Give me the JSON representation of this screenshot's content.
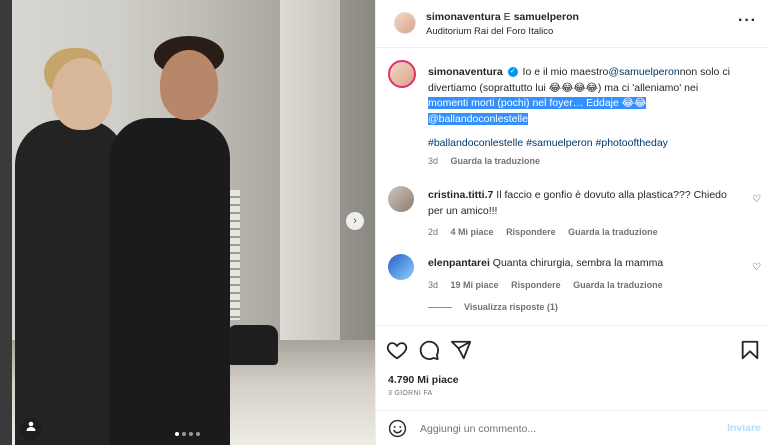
{
  "post": {
    "author": "simonaventura",
    "joiner": "E",
    "coauthor": "samuelperon",
    "location": "Auditorium Rai del Foro Italico",
    "more_icon": "more-dots-icon"
  },
  "caption": {
    "username": "simonaventura",
    "line_pre": "Io e il mio maestro",
    "mention_1": "@samuelperon",
    "line_mid": "non solo ci divertiamo (soprattutto lui 😂😂😂😂) ma ci 'alleniamo' nei",
    "highlighted": "momenti morti (pochi) nel foyer… Eddaje 😂😂",
    "mention_2": "@ballandoconlestelle",
    "hashtags": "#ballandoconlestelle #samuelperon #photooftheday",
    "age": "3d",
    "translate": "Guarda la traduzione"
  },
  "comments": [
    {
      "username": "cristina.titti.7",
      "text": "Il faccio e gonfio è dovuto alla plastica??? Chiedo per un amico!!!",
      "age": "2d",
      "likes": "4 Mi piace",
      "reply": "Rispondere",
      "translate": "Guarda la traduzione"
    },
    {
      "username": "elenpantarei",
      "text": "Quanta chirurgia, sembra la mamma",
      "age": "3d",
      "likes": "19 Mi piace",
      "reply": "Rispondere",
      "translate": "Guarda la traduzione"
    }
  ],
  "view_replies": "Visualizza risposte (1)",
  "likes_count": "4.790 Mi piace",
  "posted": "3 GIORNI FA",
  "composer": {
    "placeholder": "Aggiungi un commento...",
    "send": "Inviare"
  },
  "carousel": {
    "slides": 4,
    "active_index": 0
  },
  "colors": {
    "accent": "#0095f6",
    "link": "#00376b",
    "highlight": "#3390ff",
    "muted": "#737373"
  }
}
